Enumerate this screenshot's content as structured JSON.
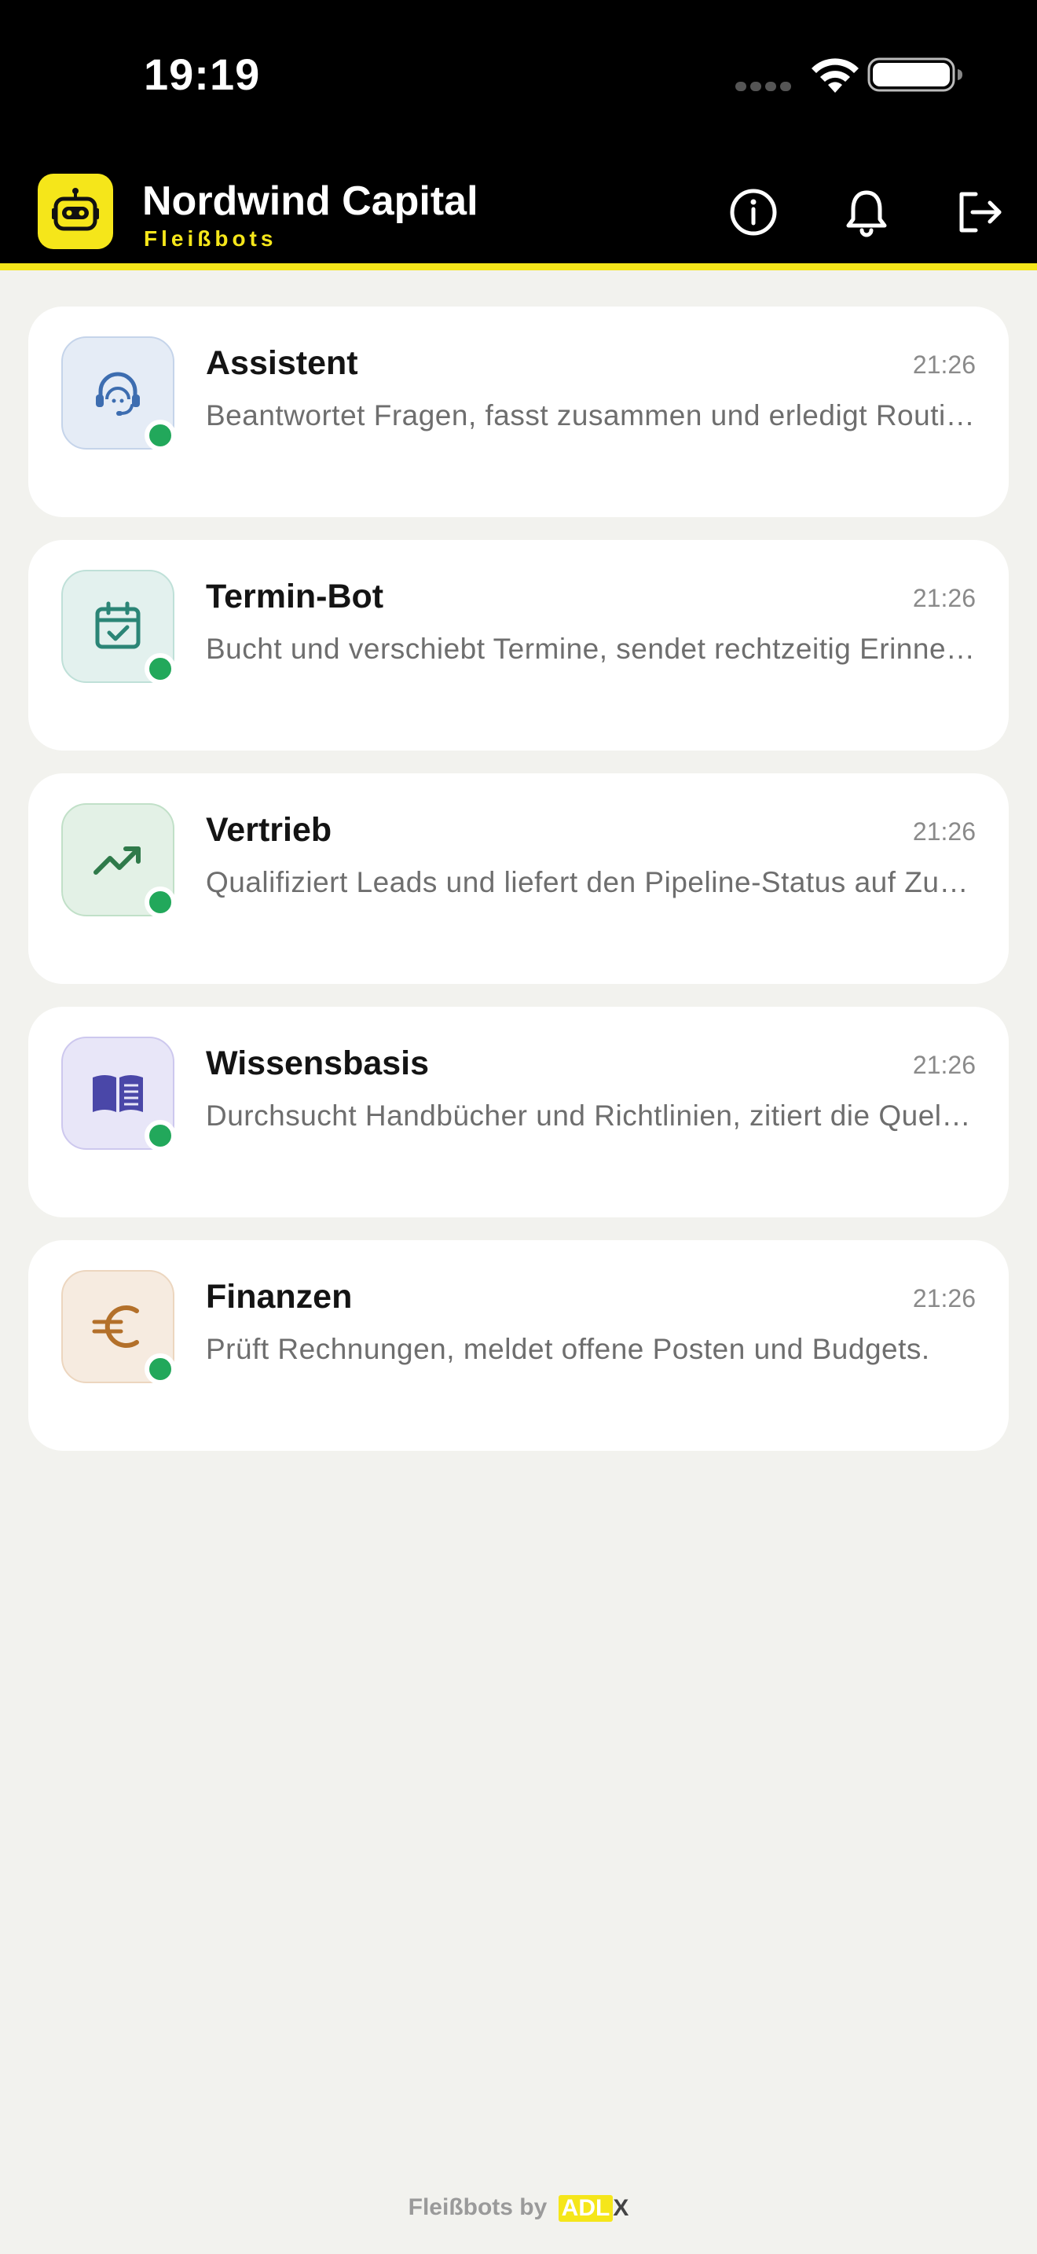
{
  "status_bar": {
    "time": "19:19",
    "icons": [
      "signal-dots-icon",
      "wifi-icon",
      "battery-icon"
    ]
  },
  "header": {
    "logo_icon": "robot-icon",
    "title": "Nordwind Capital",
    "subtitle": "Fleißbots",
    "buttons": [
      "info-icon",
      "bell-icon",
      "logout-icon"
    ],
    "accent_color": "#f5e61a"
  },
  "bots": [
    {
      "name": "Assistent",
      "time": "21:26",
      "description": "Beantwortet Fragen, fasst zusammen und erledigt Routineaufgaben.",
      "icon": "headset-person-icon",
      "status": "online"
    },
    {
      "name": "Termin-Bot",
      "time": "21:26",
      "description": "Bucht und verschiebt Termine, sendet rechtzeitig Erinnerungen.",
      "icon": "calendar-check-icon",
      "status": "online"
    },
    {
      "name": "Vertrieb",
      "time": "21:26",
      "description": "Qualifiziert Leads und liefert den Pipeline-Status auf Zuruf.",
      "icon": "trending-up-icon",
      "status": "online"
    },
    {
      "name": "Wissensbasis",
      "time": "21:26",
      "description": "Durchsucht Handbücher und Richtlinien, zitiert die Quellen.",
      "icon": "book-open-icon",
      "status": "online"
    },
    {
      "name": "Finanzen",
      "time": "21:26",
      "description": "Prüft Rechnungen, meldet offene Posten und Budgets.",
      "icon": "euro-icon",
      "status": "online"
    }
  ],
  "footer": {
    "text": "Fleißbots by",
    "brand_main": "ADL",
    "brand_suffix": "X"
  }
}
